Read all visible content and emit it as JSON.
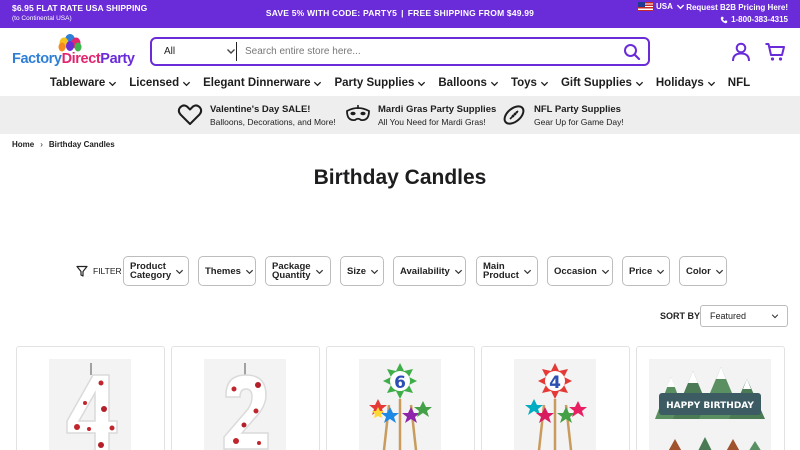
{
  "topbar": {
    "promo_left_1": "$6.95 FLAT RATE USA SHIPPING",
    "promo_left_2": "(to Continental USA)",
    "promo_center_1": "SAVE 5% WITH CODE: PARTY5",
    "promo_center_sep": "|",
    "promo_center_2": "FREE SHIPPING FROM $49.99",
    "locale": "USA",
    "b2b": "Request B2B Pricing Here!",
    "phone": "1-800-383-4315"
  },
  "logo": {
    "part1": "Factory",
    "part2": "Direct",
    "part3": "Party"
  },
  "search": {
    "category": "All",
    "placeholder": "Search entire store here..."
  },
  "nav": [
    {
      "label": "Tableware"
    },
    {
      "label": "Licensed"
    },
    {
      "label": "Elegant Dinnerware"
    },
    {
      "label": "Party Supplies"
    },
    {
      "label": "Balloons"
    },
    {
      "label": "Toys"
    },
    {
      "label": "Gift Supplies"
    },
    {
      "label": "Holidays"
    },
    {
      "label": "NFL"
    }
  ],
  "promos": [
    {
      "title": "Valentine's Day SALE!",
      "subtitle": "Balloons, Decorations, and More!",
      "icon": "heart-icon"
    },
    {
      "title": "Mardi Gras Party Supplies",
      "subtitle": "All You Need for Mardi Gras!",
      "icon": "mardi-gras-mask-icon"
    },
    {
      "title": "NFL Party Supplies",
      "subtitle": "Gear Up for Game Day!",
      "icon": "football-icon"
    }
  ],
  "breadcrumb": {
    "home": "Home",
    "sep": "›",
    "current": "Birthday Candles"
  },
  "page_title": "Birthday Candles",
  "filter_label": "FILTER",
  "filters": [
    {
      "line1": "Product",
      "line2": "Category"
    },
    {
      "line1": "Themes",
      "line2": ""
    },
    {
      "line1": "Package",
      "line2": "Quantity"
    },
    {
      "line1": "Size",
      "line2": ""
    },
    {
      "line1": "Availability",
      "line2": ""
    },
    {
      "line1": "Main",
      "line2": "Product"
    },
    {
      "line1": "Occasion",
      "line2": ""
    },
    {
      "line1": "Price",
      "line2": ""
    },
    {
      "line1": "Color",
      "line2": ""
    }
  ],
  "sort": {
    "label": "SORT BY",
    "value": "Featured"
  },
  "products": [
    {
      "image": "number-4-candle-red-confetti"
    },
    {
      "image": "number-2-candle-red-confetti"
    },
    {
      "image": "number-6-star-pick-candles"
    },
    {
      "image": "number-4-star-pick-candles"
    },
    {
      "image": "happy-birthday-mountain-candles"
    }
  ],
  "products_text": {
    "card5_banner": "HAPPY BIRTHDAY"
  },
  "colors": {
    "brand_purple": "#6a2bd9",
    "promo_bg": "#eeeeee"
  }
}
